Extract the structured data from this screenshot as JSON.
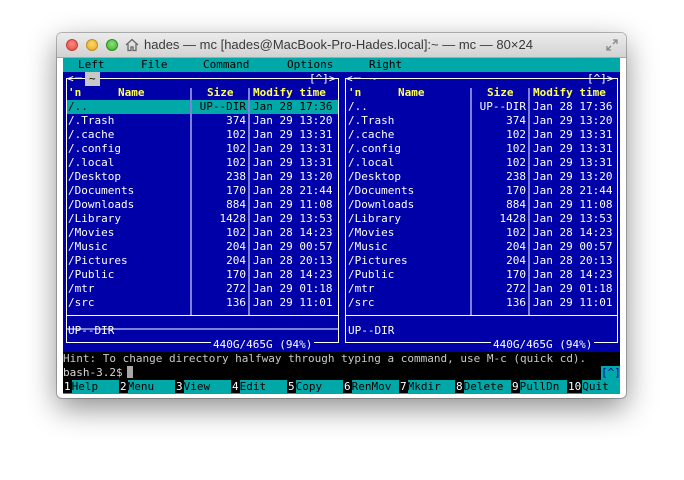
{
  "window": {
    "title": "hades — mc [hades@MacBook-Pro-Hades.local]:~ — mc — 80×24"
  },
  "menubar": [
    "Left",
    "File",
    "Command",
    "Options",
    "Right"
  ],
  "left_panel": {
    "path": "~",
    "corner": "[^]>",
    "headers": {
      "name": "Name",
      "size": "Size",
      "mtime": "Modify time",
      "sort": "'n"
    },
    "rows": [
      {
        "name": "/..",
        "size": "UP--DIR",
        "mtime": "Jan 28 17:36"
      },
      {
        "name": "/.Trash",
        "size": "374",
        "mtime": "Jan 29 13:20"
      },
      {
        "name": "/.cache",
        "size": "102",
        "mtime": "Jan 29 13:31"
      },
      {
        "name": "/.config",
        "size": "102",
        "mtime": "Jan 29 13:31"
      },
      {
        "name": "/.local",
        "size": "102",
        "mtime": "Jan 29 13:31"
      },
      {
        "name": "/Desktop",
        "size": "238",
        "mtime": "Jan 29 13:20"
      },
      {
        "name": "/Documents",
        "size": "170",
        "mtime": "Jan 28 21:44"
      },
      {
        "name": "/Downloads",
        "size": "884",
        "mtime": "Jan 29 11:08"
      },
      {
        "name": "/Library",
        "size": "1428",
        "mtime": "Jan 29 13:53"
      },
      {
        "name": "/Movies",
        "size": "102",
        "mtime": "Jan 28 14:23"
      },
      {
        "name": "/Music",
        "size": "204",
        "mtime": "Jan 29 00:57"
      },
      {
        "name": "/Pictures",
        "size": "204",
        "mtime": "Jan 28 20:13"
      },
      {
        "name": "/Public",
        "size": "170",
        "mtime": "Jan 28 14:23"
      },
      {
        "name": "/mtr",
        "size": "272",
        "mtime": "Jan 29 01:18"
      },
      {
        "name": "/src",
        "size": "136",
        "mtime": "Jan 29 11:01"
      }
    ],
    "status": "UP--DIR",
    "disk": "440G/465G (94%)"
  },
  "right_panel": {
    "path": "~",
    "corner": "[^]>",
    "headers": {
      "name": "Name",
      "size": "Size",
      "mtime": "Modify time",
      "sort": "'n"
    },
    "rows": [
      {
        "name": "/..",
        "size": "UP--DIR",
        "mtime": "Jan 28 17:36"
      },
      {
        "name": "/.Trash",
        "size": "374",
        "mtime": "Jan 29 13:20"
      },
      {
        "name": "/.cache",
        "size": "102",
        "mtime": "Jan 29 13:31"
      },
      {
        "name": "/.config",
        "size": "102",
        "mtime": "Jan 29 13:31"
      },
      {
        "name": "/.local",
        "size": "102",
        "mtime": "Jan 29 13:31"
      },
      {
        "name": "/Desktop",
        "size": "238",
        "mtime": "Jan 29 13:20"
      },
      {
        "name": "/Documents",
        "size": "170",
        "mtime": "Jan 28 21:44"
      },
      {
        "name": "/Downloads",
        "size": "884",
        "mtime": "Jan 29 11:08"
      },
      {
        "name": "/Library",
        "size": "1428",
        "mtime": "Jan 29 13:53"
      },
      {
        "name": "/Movies",
        "size": "102",
        "mtime": "Jan 28 14:23"
      },
      {
        "name": "/Music",
        "size": "204",
        "mtime": "Jan 29 00:57"
      },
      {
        "name": "/Pictures",
        "size": "204",
        "mtime": "Jan 28 20:13"
      },
      {
        "name": "/Public",
        "size": "170",
        "mtime": "Jan 28 14:23"
      },
      {
        "name": "/mtr",
        "size": "272",
        "mtime": "Jan 29 01:18"
      },
      {
        "name": "/src",
        "size": "136",
        "mtime": "Jan 29 11:01"
      }
    ],
    "status": "UP--DIR",
    "disk": "440G/465G (94%)"
  },
  "hint": "Hint: To change directory halfway through typing a command, use M-c (quick cd).",
  "command_line": {
    "prompt": "bash-3.2$",
    "corner": "[^]"
  },
  "fkeys": [
    {
      "num": "1",
      "label": "Help"
    },
    {
      "num": "2",
      "label": "Menu"
    },
    {
      "num": "3",
      "label": "View"
    },
    {
      "num": "4",
      "label": "Edit"
    },
    {
      "num": "5",
      "label": "Copy"
    },
    {
      "num": "6",
      "label": "RenMov"
    },
    {
      "num": "7",
      "label": "Mkdir"
    },
    {
      "num": "8",
      "label": "Delete"
    },
    {
      "num": "9",
      "label": "PullDn"
    },
    {
      "num": "10",
      "label": "Quit"
    }
  ],
  "colors": {
    "terminal_bg": "#0000a8",
    "cyan": "#00a8a8",
    "header_yellow": "#ffff54",
    "text": "#ffffff"
  },
  "icons": [
    "close-icon",
    "minimize-icon",
    "maximize-icon",
    "home-icon",
    "fullscreen-icon"
  ]
}
